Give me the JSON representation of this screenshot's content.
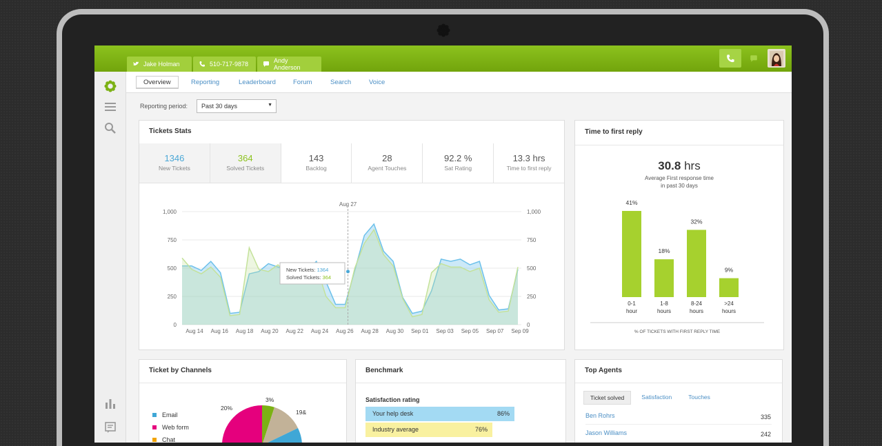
{
  "topbar": {
    "tabs": [
      {
        "icon": "twitter-bird-icon",
        "label": "Jake Holman"
      },
      {
        "icon": "phone-icon",
        "label": "510-717-9878"
      },
      {
        "icon": "chat-bubble-icon",
        "label": "Andy Anderson"
      }
    ],
    "colors": {
      "accent": "#7cb114",
      "tab": "#a2cf3c"
    }
  },
  "subnav": [
    "Overview",
    "Reporting",
    "Leaderboard",
    "Forum",
    "Search",
    "Voice"
  ],
  "reporting_period": {
    "label": "Reporting period:",
    "value": "Past 30 days"
  },
  "tickets_stats": {
    "title": "Tickets Stats",
    "stats": [
      {
        "value": "1346",
        "label": "New Tickets",
        "color": "#4aa7d6"
      },
      {
        "value": "364",
        "label": "Solved Tickets",
        "color": "#8cc21e"
      },
      {
        "value": "143",
        "label": "Backlog",
        "color": "#555555"
      },
      {
        "value": "28",
        "label": "Agent Touches",
        "color": "#555555"
      },
      {
        "value": "92.2 %",
        "label": "Sat Rating",
        "color": "#555555"
      },
      {
        "value": "13.3 hrs",
        "label": "Time to first reply",
        "color": "#555555"
      }
    ],
    "tooltip": {
      "new_label": "New Tickets:",
      "new_value": "1364",
      "solved_label": "Solved Tickets:",
      "solved_value": "364"
    }
  },
  "chart_data": [
    {
      "type": "area",
      "marker_label": "Aug 27",
      "x_ticks": [
        "Aug 14",
        "Aug 16",
        "Aug 18",
        "Aug 20",
        "Aug 22",
        "Aug 24",
        "Aug 26",
        "Aug 28",
        "Aug 30",
        "Sep 01",
        "Sep 03",
        "Sep 05",
        "Sep 07",
        "Sep 09"
      ],
      "y_ticks": [
        "0",
        "250",
        "500",
        "750",
        "1,000"
      ],
      "ylim": [
        0,
        1000
      ],
      "series": [
        {
          "values": [
            520,
            520,
            480,
            560,
            460,
            100,
            110,
            450,
            470,
            540,
            510,
            490,
            520,
            480,
            560,
            380,
            180,
            180,
            480,
            790,
            890,
            650,
            560,
            240,
            100,
            120,
            300,
            580,
            560,
            580,
            530,
            560,
            260,
            130,
            140,
            490
          ],
          "color": "#6cc0ea"
        },
        {
          "values": [
            590,
            490,
            450,
            510,
            420,
            80,
            90,
            680,
            490,
            470,
            530,
            430,
            460,
            450,
            520,
            250,
            150,
            150,
            500,
            720,
            840,
            620,
            520,
            230,
            70,
            90,
            460,
            540,
            510,
            510,
            470,
            500,
            220,
            110,
            120,
            510
          ],
          "color": "#c4e29a"
        }
      ]
    },
    {
      "type": "bar",
      "title": "Time to first reply",
      "categories": [
        "0-1 hour",
        "1-8 hours",
        "8-24 hours",
        ">24 hours"
      ],
      "values": [
        41,
        18,
        32,
        9
      ],
      "value_labels": [
        "41%",
        "18%",
        "32%",
        "9%"
      ],
      "xlabel": "% OF TICKETS WITH FIRST REPLY TIME",
      "color": "#a6d12e"
    },
    {
      "type": "pie",
      "title": "Ticket by Channels",
      "slices": [
        {
          "name": "Email",
          "color": "#3fa7d6"
        },
        {
          "name": "Web form",
          "color": "#e5007d"
        },
        {
          "name": "Chat",
          "color": "#f2a400"
        }
      ],
      "visible_labels": [
        "3%",
        "19&",
        "20%"
      ],
      "values": [
        3,
        19,
        20
      ]
    }
  ],
  "time_to_first_reply": {
    "value": "30.8",
    "unit": "hrs",
    "sub1": "Average First response time",
    "sub2": "in past 30 days"
  },
  "benchmark": {
    "title": "Benchmark",
    "section": "Satisfaction rating",
    "bars": [
      {
        "label": "Your help desk",
        "pct": "86%",
        "color": "#a3daf3"
      },
      {
        "label": "Industry average",
        "pct": "76%",
        "color": "#f9f1a0"
      }
    ]
  },
  "top_agents": {
    "title": "Top Agents",
    "tabs": [
      "Ticket solved",
      "Satisfaction",
      "Touches"
    ],
    "rows": [
      {
        "name": "Ben Rohrs",
        "value": "335"
      },
      {
        "name": "Jason Williams",
        "value": "242"
      }
    ]
  }
}
